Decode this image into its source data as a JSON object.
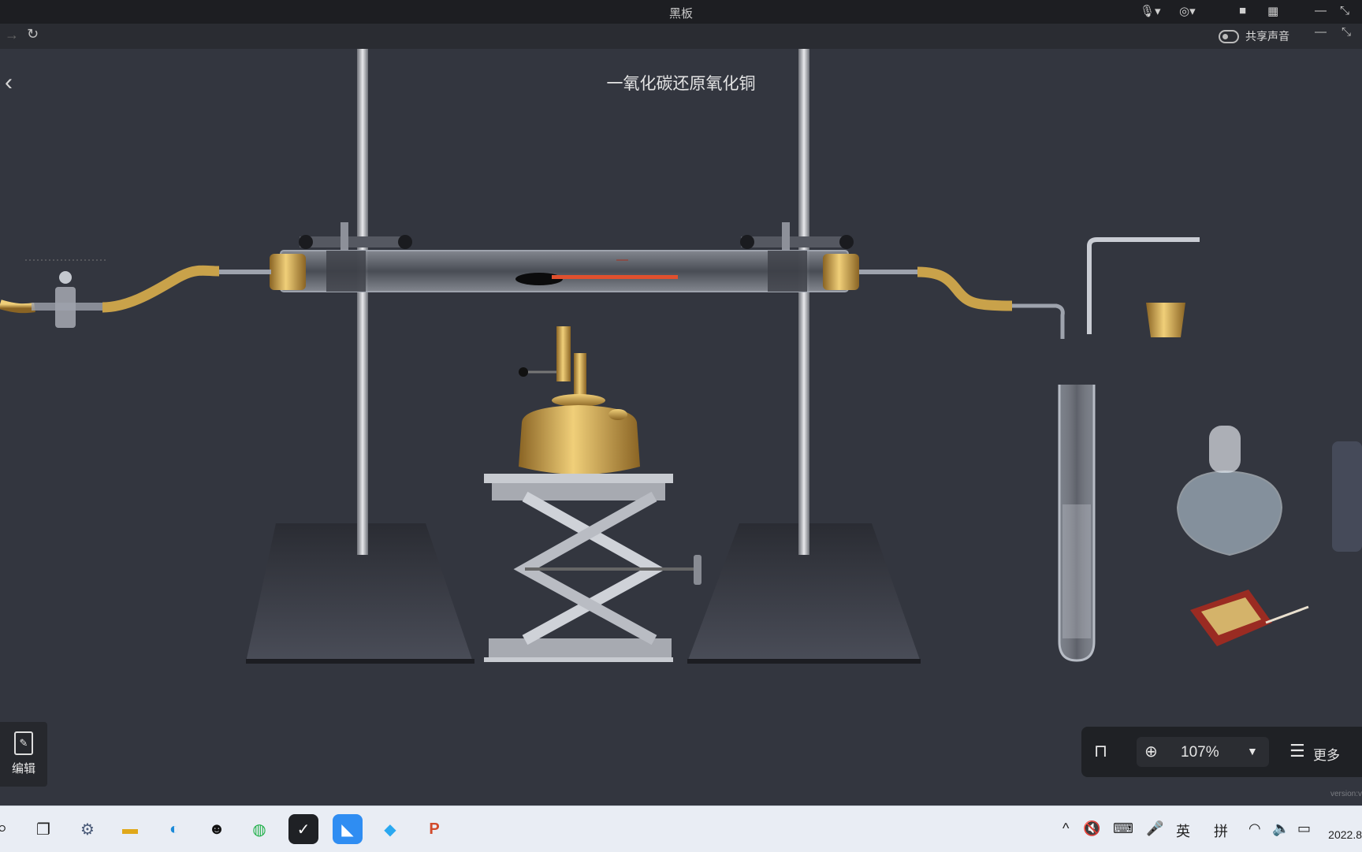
{
  "window": {
    "title": "黑板"
  },
  "toolbar": {
    "share_audio_label": "共享声音"
  },
  "scene": {
    "title": "一氧化碳还原氧化铜"
  },
  "left_panel": {
    "edit_label": "编辑"
  },
  "zoom_bar": {
    "zoom_level": "107%",
    "more_label": "更多"
  },
  "footer": {
    "version_label": "version:v"
  },
  "taskbar": {
    "tray": {
      "ime_lang": "英",
      "ime_mode": "拼",
      "clock": "2022.8"
    }
  },
  "icons": {
    "back": "chevron-left-icon",
    "forward": "arrow-right-icon",
    "refresh": "refresh-icon",
    "mic_muted": "mic-muted-icon",
    "camera_muted": "camera-muted-icon",
    "video": "video-icon",
    "grid": "grid-icon",
    "lock": "unlock-icon",
    "locate": "locate-icon",
    "menu": "list-icon"
  },
  "colors": {
    "background": "#33363f",
    "brass": "#c9a24a",
    "flame": "#e0502e"
  }
}
